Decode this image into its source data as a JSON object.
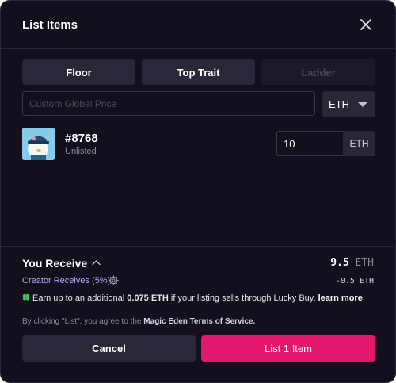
{
  "header": {
    "title": "List Items"
  },
  "pricing_tabs": [
    {
      "label": "Floor"
    },
    {
      "label": "Top Trait"
    },
    {
      "label": "Ladder"
    }
  ],
  "global_price": {
    "placeholder": "Custom Global Price",
    "currency": "ETH"
  },
  "item": {
    "name": "#8768",
    "status": "Unlisted",
    "price_value": "10",
    "price_unit": "ETH"
  },
  "summary": {
    "you_receive_label": "You Receive",
    "total_value": "9.5",
    "total_unit": "ETH",
    "creator_label": "Creator Receives (5%)",
    "creator_fee": "-0.5 ETH"
  },
  "promo": {
    "prefix": "Earn up to an additional ",
    "amount": "0.075 ETH",
    "suffix": " if your listing sells through Lucky Buy, ",
    "link": "learn more"
  },
  "terms": {
    "prefix": "By clicking \"List\", you agree to the ",
    "link": "Magic Eden Terms of Service",
    "suffix": "."
  },
  "actions": {
    "cancel_label": "Cancel",
    "list_label": "List 1 Item"
  },
  "colors": {
    "background": "#130f1c",
    "accent": "#e4186c",
    "creator_text": "#b7a8ff"
  }
}
